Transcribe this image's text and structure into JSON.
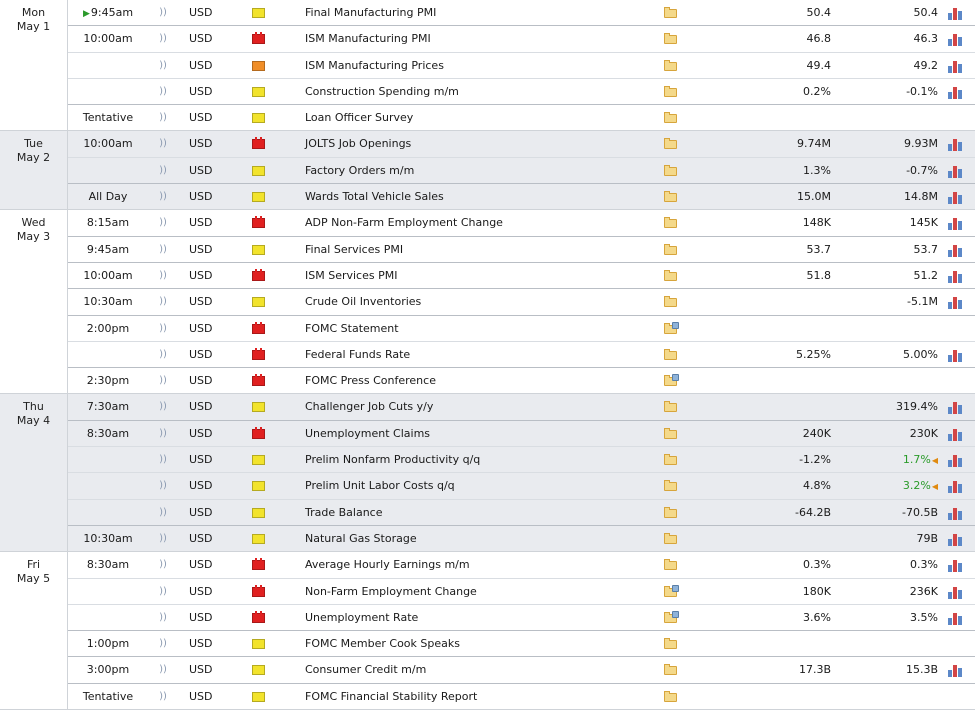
{
  "colors": {
    "alt_row_bg": "#e9ebef",
    "better_forecast": "#2a9b2a",
    "high_impact": "#e02020",
    "medium_impact": "#f08e28",
    "low_impact": "#f2e32c"
  },
  "days": [
    {
      "weekday": "Mon",
      "date": "May 1",
      "alt": false,
      "events": [
        {
          "time": "9:45am",
          "current": true,
          "currency": "USD",
          "impact": "yellow",
          "title": "Final Manufacturing PMI",
          "actual": "50.4",
          "forecast": "50.4"
        },
        {
          "time": "10:00am",
          "currency": "USD",
          "impact": "red",
          "title": "ISM Manufacturing PMI",
          "actual": "46.8",
          "forecast": "46.3"
        },
        {
          "time": "",
          "currency": "USD",
          "impact": "orange",
          "title": "ISM Manufacturing Prices",
          "actual": "49.4",
          "forecast": "49.2"
        },
        {
          "time": "",
          "currency": "USD",
          "impact": "yellow",
          "title": "Construction Spending m/m",
          "actual": "0.2%",
          "forecast": "-0.1%"
        },
        {
          "time": "Tentative",
          "currency": "USD",
          "impact": "yellow",
          "title": "Loan Officer Survey",
          "actual": "",
          "forecast": "",
          "no_graph": true
        }
      ]
    },
    {
      "weekday": "Tue",
      "date": "May 2",
      "alt": true,
      "events": [
        {
          "time": "10:00am",
          "currency": "USD",
          "impact": "red",
          "title": "JOLTS Job Openings",
          "actual": "9.74M",
          "forecast": "9.93M"
        },
        {
          "time": "",
          "currency": "USD",
          "impact": "yellow",
          "title": "Factory Orders m/m",
          "actual": "1.3%",
          "forecast": "-0.7%"
        },
        {
          "time": "All Day",
          "currency": "USD",
          "impact": "yellow",
          "title": "Wards Total Vehicle Sales",
          "actual": "15.0M",
          "forecast": "14.8M"
        }
      ]
    },
    {
      "weekday": "Wed",
      "date": "May 3",
      "alt": false,
      "events": [
        {
          "time": "8:15am",
          "currency": "USD",
          "impact": "red",
          "title": "ADP Non-Farm Employment Change",
          "actual": "148K",
          "forecast": "145K"
        },
        {
          "time": "9:45am",
          "currency": "USD",
          "impact": "yellow",
          "title": "Final Services PMI",
          "actual": "53.7",
          "forecast": "53.7"
        },
        {
          "time": "10:00am",
          "currency": "USD",
          "impact": "red",
          "title": "ISM Services PMI",
          "actual": "51.8",
          "forecast": "51.2"
        },
        {
          "time": "10:30am",
          "currency": "USD",
          "impact": "yellow",
          "title": "Crude Oil Inventories",
          "actual": "",
          "forecast": "-5.1M"
        },
        {
          "time": "2:00pm",
          "currency": "USD",
          "impact": "red",
          "title": "FOMC Statement",
          "actual": "",
          "forecast": "",
          "updated": true,
          "no_graph": true
        },
        {
          "time": "",
          "currency": "USD",
          "impact": "red",
          "title": "Federal Funds Rate",
          "actual": "5.25%",
          "forecast": "5.00%"
        },
        {
          "time": "2:30pm",
          "currency": "USD",
          "impact": "red",
          "title": "FOMC Press Conference",
          "actual": "",
          "forecast": "",
          "updated": true,
          "no_graph": true
        }
      ]
    },
    {
      "weekday": "Thu",
      "date": "May 4",
      "alt": true,
      "events": [
        {
          "time": "7:30am",
          "currency": "USD",
          "impact": "yellow",
          "title": "Challenger Job Cuts y/y",
          "actual": "",
          "forecast": "319.4%"
        },
        {
          "time": "8:30am",
          "currency": "USD",
          "impact": "red",
          "title": "Unemployment Claims",
          "actual": "240K",
          "forecast": "230K"
        },
        {
          "time": "",
          "currency": "USD",
          "impact": "yellow",
          "title": "Prelim Nonfarm Productivity q/q",
          "actual": "-1.2%",
          "forecast": "1.7%",
          "revised": true
        },
        {
          "time": "",
          "currency": "USD",
          "impact": "yellow",
          "title": "Prelim Unit Labor Costs q/q",
          "actual": "4.8%",
          "forecast": "3.2%",
          "revised": true
        },
        {
          "time": "",
          "currency": "USD",
          "impact": "yellow",
          "title": "Trade Balance",
          "actual": "-64.2B",
          "forecast": "-70.5B"
        },
        {
          "time": "10:30am",
          "currency": "USD",
          "impact": "yellow",
          "title": "Natural Gas Storage",
          "actual": "",
          "forecast": "79B"
        }
      ]
    },
    {
      "weekday": "Fri",
      "date": "May 5",
      "alt": false,
      "events": [
        {
          "time": "8:30am",
          "currency": "USD",
          "impact": "red",
          "title": "Average Hourly Earnings m/m",
          "actual": "0.3%",
          "forecast": "0.3%"
        },
        {
          "time": "",
          "currency": "USD",
          "impact": "red",
          "title": "Non-Farm Employment Change",
          "actual": "180K",
          "forecast": "236K",
          "updated": true
        },
        {
          "time": "",
          "currency": "USD",
          "impact": "red",
          "title": "Unemployment Rate",
          "actual": "3.6%",
          "forecast": "3.5%",
          "updated": true
        },
        {
          "time": "1:00pm",
          "currency": "USD",
          "impact": "yellow",
          "title": "FOMC Member Cook Speaks",
          "actual": "",
          "forecast": "",
          "no_graph": true
        },
        {
          "time": "3:00pm",
          "currency": "USD",
          "impact": "yellow",
          "title": "Consumer Credit m/m",
          "actual": "17.3B",
          "forecast": "15.3B"
        },
        {
          "time": "Tentative",
          "currency": "USD",
          "impact": "yellow",
          "title": "FOMC Financial Stability Report",
          "actual": "",
          "forecast": "",
          "no_graph": true
        }
      ]
    }
  ]
}
